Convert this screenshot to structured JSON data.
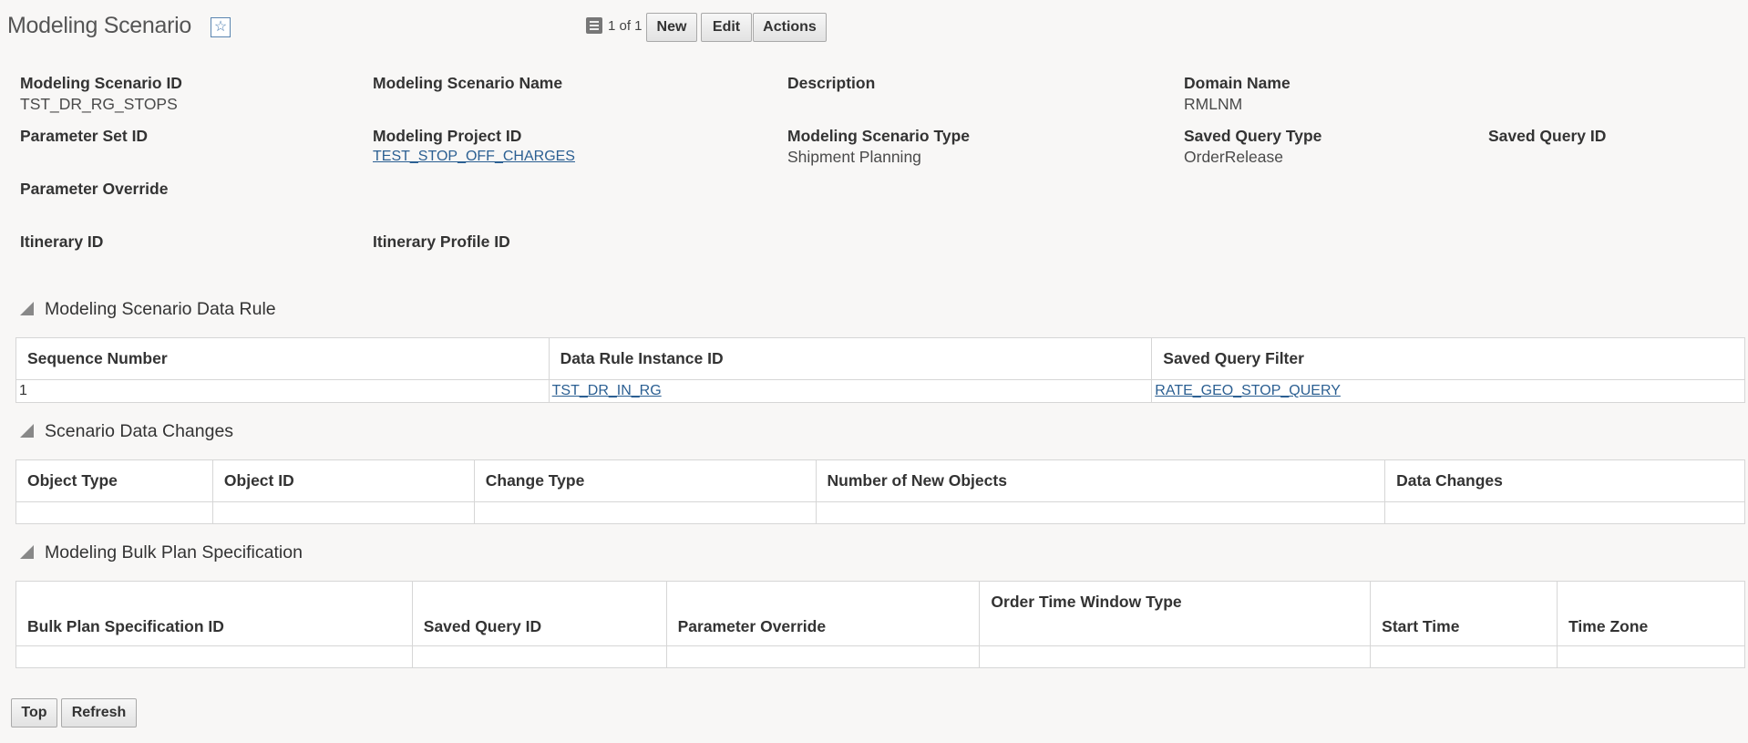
{
  "header": {
    "title": "Modeling Scenario",
    "favorite_icon": "star-icon",
    "pager_icon": "list-icon",
    "pager_text": "1 of 1",
    "buttons": {
      "new": "New",
      "edit": "Edit",
      "actions": "Actions"
    }
  },
  "fields": {
    "scenario_id_label": "Modeling Scenario ID",
    "scenario_id_value": "TST_DR_RG_STOPS",
    "scenario_name_label": "Modeling Scenario Name",
    "description_label": "Description",
    "domain_label": "Domain Name",
    "domain_value": "RMLNM",
    "param_set_label": "Parameter Set ID",
    "project_id_label": "Modeling Project ID",
    "project_id_value": "TEST_STOP_OFF_CHARGES",
    "scenario_type_label": "Modeling Scenario Type",
    "scenario_type_value": "Shipment Planning",
    "saved_query_type_label": "Saved Query Type",
    "saved_query_type_value": "OrderRelease",
    "saved_query_id_label": "Saved Query ID",
    "param_override_label": "Parameter Override",
    "itinerary_label": "Itinerary ID",
    "itinerary_profile_label": "Itinerary Profile ID"
  },
  "data_rule": {
    "title": "Modeling Scenario Data Rule",
    "columns": [
      "Sequence Number",
      "Data Rule Instance ID",
      "Saved Query Filter"
    ],
    "rows": [
      {
        "seq": "1",
        "rule": "TST_DR_IN_RG",
        "filter": "RATE_GEO_STOP_QUERY"
      }
    ]
  },
  "data_changes": {
    "title": "Scenario Data Changes",
    "columns": [
      "Object Type",
      "Object ID",
      "Change Type",
      "Number of New Objects",
      "Data Changes"
    ]
  },
  "bulk_plan": {
    "title": "Modeling Bulk Plan Specification",
    "columns": [
      "Bulk Plan Specification ID",
      "Saved Query ID",
      "Parameter Override",
      "Order Time Window Type",
      "Start Time",
      "Time Zone"
    ]
  },
  "footer": {
    "top": "Top",
    "refresh": "Refresh"
  }
}
